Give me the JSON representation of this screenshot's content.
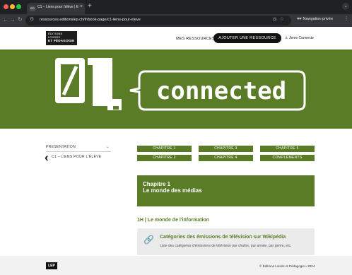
{
  "browser": {
    "tab_title": "C1 – Liens pour l'élève | ED",
    "tab_favicon": "ED",
    "new_tab_label": "+",
    "url": "ressources.editionslep.ch/fr/book-page/c1-liens-pour-eleve",
    "incognito_label": "Navigation privée"
  },
  "header": {
    "logo_line1": "ÉDITIONS",
    "logo_line2": "LOISIRS",
    "logo_line3": "ET PÉDAGOGIE",
    "my_resources": "MES RESSOURCES",
    "add_resource": "AJOUTER UNE RESSOURCE",
    "user_label": "Jeme Connecte"
  },
  "hero": {
    "number_text": "01",
    "word": "connected",
    "background": "#5a7c27"
  },
  "sidebar": {
    "items": [
      {
        "label": "PRESENTATION"
      },
      {
        "label": "C1 – LIENS POUR L'ÉLÈVE"
      }
    ]
  },
  "chapters": {
    "buttons": [
      {
        "label": "CHAPITRE 1"
      },
      {
        "label": "CHAPITRE 3"
      },
      {
        "label": "CHAPITRE 5"
      },
      {
        "label": "CHAPITRE 2"
      },
      {
        "label": "CHAPITRE 4"
      },
      {
        "label": "COMPLÉMENTS"
      }
    ]
  },
  "chapter_box": {
    "line1": "Chapitre 1",
    "line2": "Le monde des médias"
  },
  "section": {
    "title": "1H | Le monde de l'information"
  },
  "resource": {
    "title": "Catégories des émissions de télévision sur Wikipédia",
    "description": "Liste des catégories d'émissions de télévision par chaîne, par année, par genre, etc.",
    "icon": "link-icon"
  },
  "footer": {
    "logo": "LEP",
    "copyright": "© Éditions Loisirs et Pédagogie • 2024"
  },
  "colors": {
    "accent": "#5a7c27",
    "dark": "#111111"
  }
}
